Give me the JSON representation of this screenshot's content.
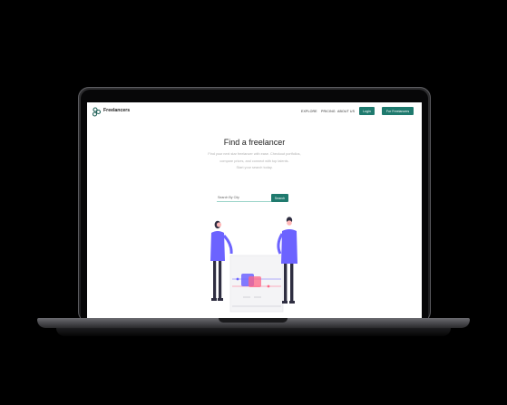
{
  "brand": {
    "name": "Freelancers"
  },
  "nav": {
    "links": [
      "EXPLORE",
      "PRICING",
      "ABOUT US"
    ],
    "login_label": "Login",
    "cta_label": "For Freelancers"
  },
  "hero": {
    "title": "Find a freelancer",
    "subtitle_lines": [
      "Find your next star freelancer with ease. Checkout portfolios,",
      "compare prices, and connect with top talents.",
      "Start your search today."
    ]
  },
  "search": {
    "placeholder": "Search By City",
    "button_label": "Search"
  },
  "colors": {
    "accent": "#1f7a6e",
    "figure_shirt": "#6c63ff",
    "text": "#222222"
  },
  "icons": {
    "logo": "people-group-icon"
  }
}
